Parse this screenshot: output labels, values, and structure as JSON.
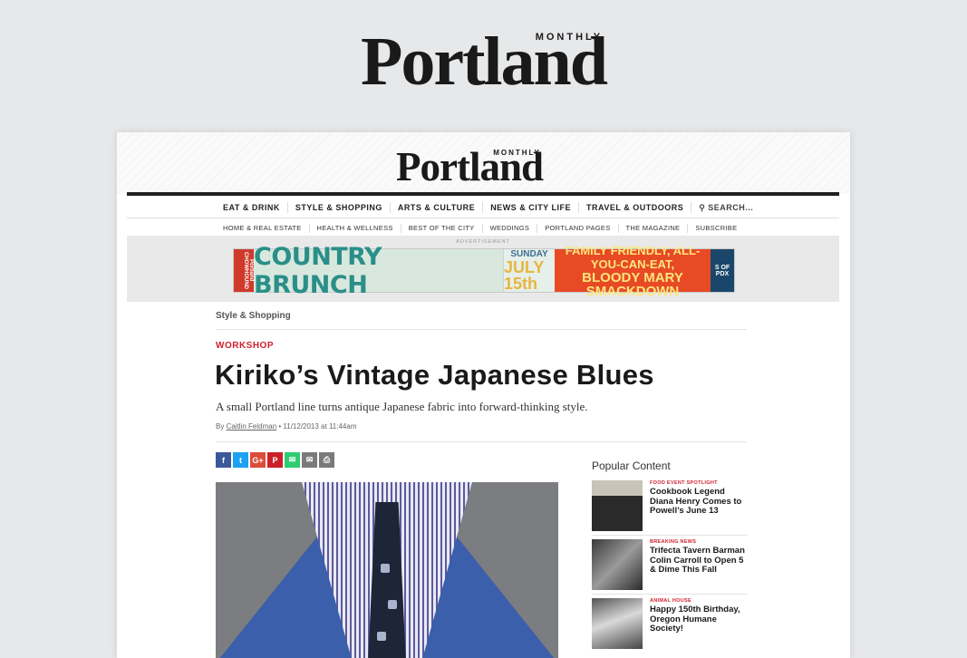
{
  "brand": {
    "name": "Portland",
    "tagline": "MONTHLY"
  },
  "nav_primary": [
    "EAT & DRINK",
    "STYLE & SHOPPING",
    "ARTS & CULTURE",
    "NEWS & CITY LIFE",
    "TRAVEL & OUTDOORS"
  ],
  "search_label": "SEARCH...",
  "nav_secondary": [
    "HOME & REAL ESTATE",
    "HEALTH & WELLNESS",
    "BEST OF THE CITY",
    "WEDDINGS",
    "PORTLAND PAGES",
    "THE MAGAZINE",
    "SUBSCRIBE"
  ],
  "ad": {
    "label": "ADVERTISEMENT",
    "brand_strip": "Portland CHOWHOUND",
    "headline": "COUNTRY BRUNCH",
    "day": "SUNDAY",
    "date": "JULY 15th",
    "promo_line1": "FAMILY FRIENDLY, ALL-YOU-CAN-EAT,",
    "promo_line2": "BLOODY MARY SMACKDOWN",
    "venue": "S OF",
    "venue2": "PDX"
  },
  "article": {
    "breadcrumb": "Style & Shopping",
    "kicker": "WORKSHOP",
    "headline": "Kiriko’s Vintage Japanese Blues",
    "dek": "A small Portland line turns antique Japanese fabric into forward-thinking style.",
    "byline_prefix": "By ",
    "author": "Caitlin Feldman",
    "timestamp": " • 11/12/2013 at 11:44am"
  },
  "share_icons": [
    {
      "name": "facebook-icon",
      "glyph": "f",
      "color": "#3b5998"
    },
    {
      "name": "twitter-icon",
      "glyph": "t",
      "color": "#1da1f2"
    },
    {
      "name": "google-plus-icon",
      "glyph": "G+",
      "color": "#dd4b39"
    },
    {
      "name": "pinterest-icon",
      "glyph": "P",
      "color": "#cb2027"
    },
    {
      "name": "sms-icon",
      "glyph": "✉",
      "color": "#2ecc71"
    },
    {
      "name": "email-icon",
      "glyph": "✉",
      "color": "#7a7a7a"
    },
    {
      "name": "print-icon",
      "glyph": "⎙",
      "color": "#7a7a7a"
    }
  ],
  "popular": {
    "title": "Popular Content",
    "items": [
      {
        "tag": "FOOD EVENT SPOTLIGHT",
        "title": "Cookbook Legend Diana Henry Comes to Powell’s June 13"
      },
      {
        "tag": "BREAKING NEWS",
        "title": "Trifecta Tavern Barman Colin Carroll to Open 5 & Dime This Fall"
      },
      {
        "tag": "ANIMAL HOUSE",
        "title": "Happy 150th Birthday, Oregon Humane Society!"
      }
    ]
  },
  "colors": {
    "accent_red": "#d2202f",
    "ink": "#1a1a1a",
    "page_bg": "#e7e8ea"
  }
}
